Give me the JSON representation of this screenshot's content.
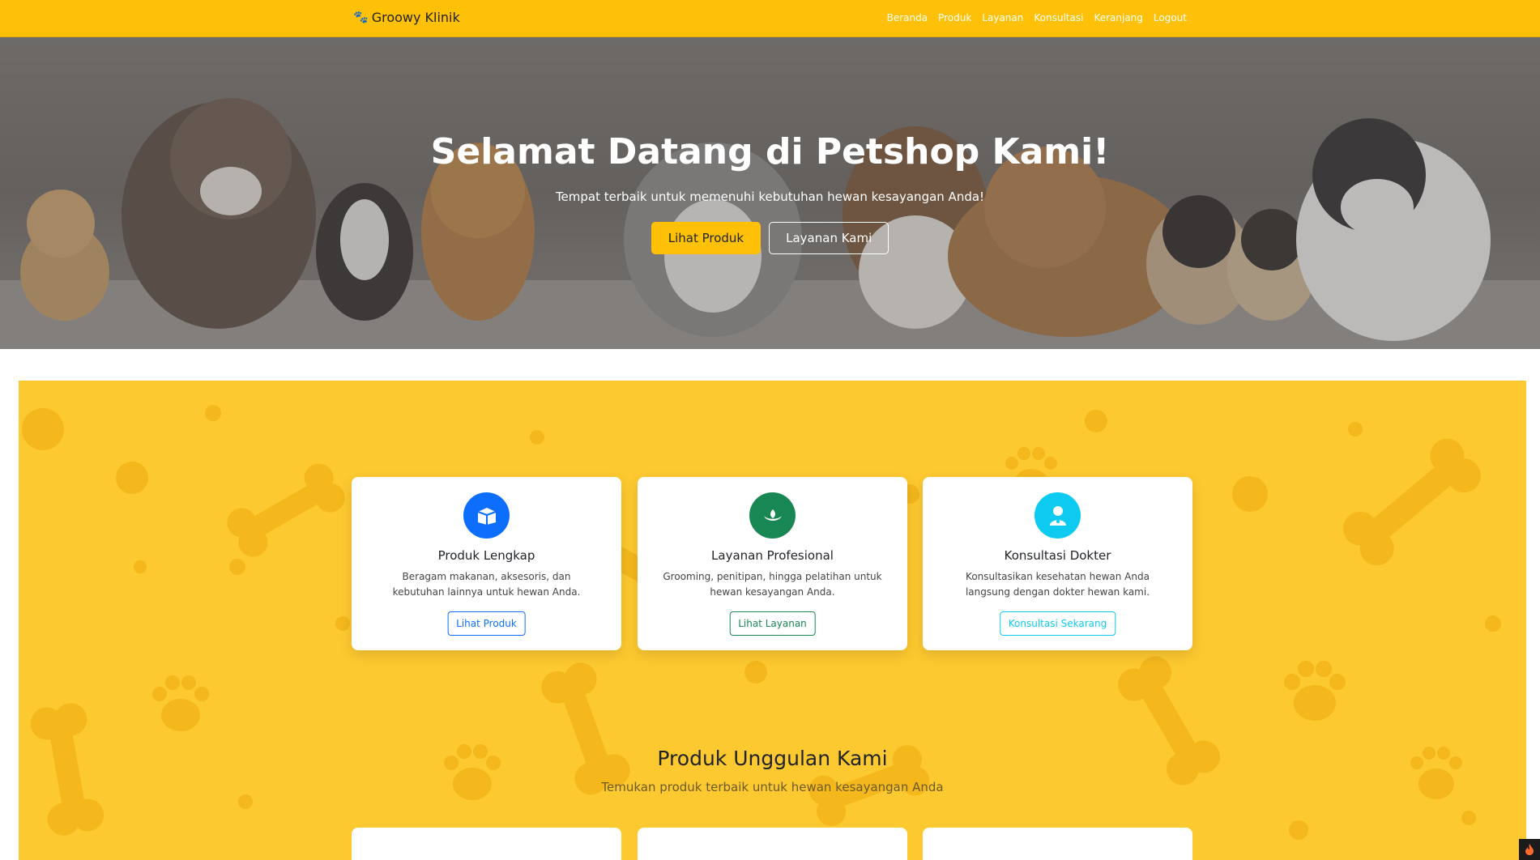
{
  "navbar": {
    "brand": "Groowy Klinik",
    "links": [
      "Beranda",
      "Produk",
      "Layanan",
      "Konsultasi",
      "Keranjang",
      "Logout"
    ]
  },
  "hero": {
    "title": "Selamat Datang di Petshop Kami!",
    "subtitle": "Tempat terbaik untuk memenuhi kebutuhan hewan kesayangan Anda!",
    "primary_button": "Lihat Produk",
    "secondary_button": "Layanan Kami"
  },
  "features": [
    {
      "icon": "box-icon",
      "color": "#0d6efd",
      "title": "Produk Lengkap",
      "text": "Beragam makanan, aksesoris, dan kebutuhan lainnya untuk hewan Anda.",
      "button": "Lihat Produk"
    },
    {
      "icon": "leaf-icon",
      "color": "#198754",
      "title": "Layanan Profesional",
      "text": "Grooming, penitipan, hingga pelatihan untuk hewan kesayangan Anda.",
      "button": "Lihat Layanan"
    },
    {
      "icon": "doctor-icon",
      "color": "#0dcaf0",
      "title": "Konsultasi Dokter",
      "text": "Konsultasikan kesehatan hewan Anda langsung dengan dokter hewan kami.",
      "button": "Konsultasi Sekarang"
    }
  ],
  "featured": {
    "title": "Produk Unggulan Kami",
    "subtitle": "Temukan produk terbaik untuk hewan kesayangan Anda"
  },
  "colors": {
    "primary_yellow": "#ffc107",
    "pattern_yellow": "#fdc930"
  }
}
